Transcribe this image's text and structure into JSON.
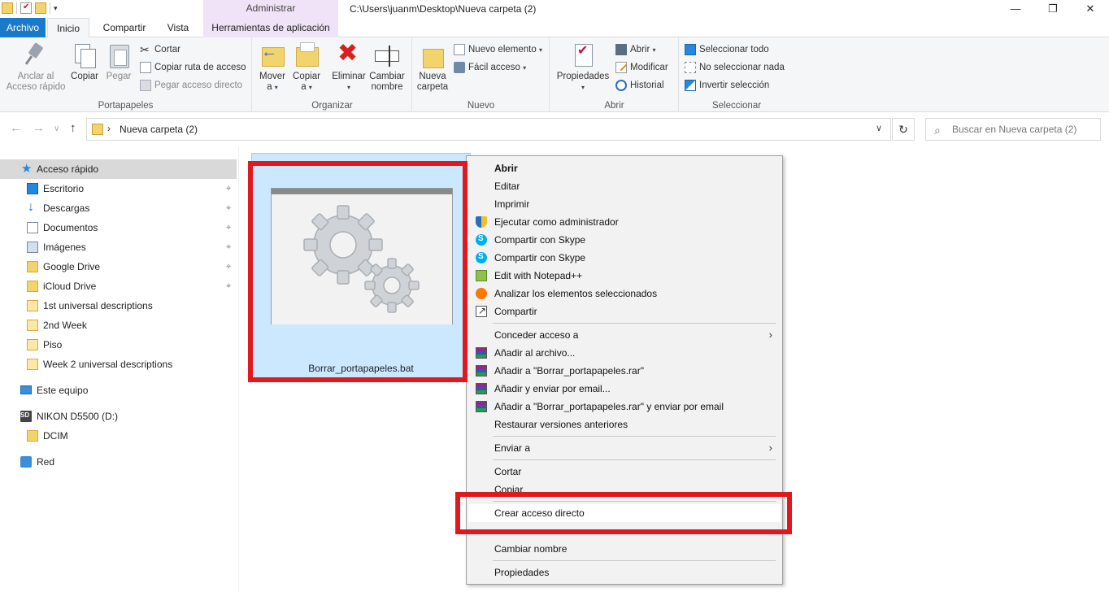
{
  "window": {
    "qat_arrow": "▾",
    "context_tab_group": "Administrar",
    "path_title": "C:\\Users\\juanm\\Desktop\\Nueva carpeta (2)",
    "minimize": "—",
    "maximize": "❐",
    "close": "✕"
  },
  "tabs": {
    "archivo": "Archivo",
    "inicio": "Inicio",
    "compartir": "Compartir",
    "vista": "Vista",
    "herramientas": "Herramientas de aplicación",
    "collapse": "∧",
    "help": "?"
  },
  "ribbon": {
    "portapapeles": {
      "label": "Portapapeles",
      "pin_line1": "Anclar al",
      "pin_line2": "Acceso rápido",
      "copy": "Copiar",
      "paste": "Pegar",
      "cut": "Cortar",
      "copy_path": "Copiar ruta de acceso",
      "paste_link": "Pegar acceso directo"
    },
    "organizar": {
      "label": "Organizar",
      "move_line1": "Mover",
      "move_line2": "a",
      "copy_line1": "Copiar",
      "copy_line2": "a",
      "delete": "Eliminar",
      "rename_line1": "Cambiar",
      "rename_line2": "nombre"
    },
    "nuevo": {
      "label": "Nuevo",
      "new_folder_line1": "Nueva",
      "new_folder_line2": "carpeta",
      "new_item": "Nuevo elemento",
      "easy_access": "Fácil acceso"
    },
    "abrir": {
      "label": "Abrir",
      "properties": "Propiedades",
      "open": "Abrir",
      "edit": "Modificar",
      "history": "Historial"
    },
    "seleccionar": {
      "label": "Seleccionar",
      "select_all": "Seleccionar todo",
      "select_none": "No seleccionar nada",
      "invert": "Invertir selección"
    },
    "dropdown_arrow": "▾"
  },
  "navbar": {
    "back": "←",
    "forward": "→",
    "recent": "∨",
    "up": "↑",
    "chevron": "›",
    "address": "Nueva carpeta (2)",
    "address_dropdown": "∨",
    "refresh": "↻",
    "search_icon": "⌕",
    "search_placeholder": "Buscar en Nueva carpeta (2)"
  },
  "sidebar": {
    "pin_glyph": "⌖",
    "quick_access": "Acceso rápido",
    "quick_items": [
      {
        "label": "Escritorio"
      },
      {
        "label": "Descargas"
      },
      {
        "label": "Documentos"
      },
      {
        "label": "Imágenes"
      },
      {
        "label": "Google Drive"
      },
      {
        "label": "iCloud Drive"
      },
      {
        "label": "1st universal descriptions"
      },
      {
        "label": "2nd Week"
      },
      {
        "label": "Piso"
      },
      {
        "label": "Week 2 universal descriptions"
      }
    ],
    "this_pc": "Este equipo",
    "drive": "NIKON D5500 (D:)",
    "drive_folder": "DCIM",
    "network": "Red"
  },
  "file": {
    "name": "Borrar_portapapeles.bat"
  },
  "context_menu": {
    "items": [
      {
        "label": "Abrir"
      },
      {
        "label": "Editar"
      },
      {
        "label": "Imprimir"
      },
      {
        "label": "Ejecutar como administrador"
      },
      {
        "label": "Compartir con Skype"
      },
      {
        "label": "Compartir con Skype"
      },
      {
        "label": "Edit with Notepad++"
      },
      {
        "label": "Analizar los elementos seleccionados"
      },
      {
        "label": "Compartir"
      },
      {
        "label": "Conceder acceso a"
      },
      {
        "label": "Añadir al archivo..."
      },
      {
        "label": "Añadir a \"Borrar_portapapeles.rar\""
      },
      {
        "label": "Añadir y enviar por email..."
      },
      {
        "label": "Añadir a \"Borrar_portapapeles.rar\" y enviar por email"
      },
      {
        "label": "Restaurar versiones anteriores"
      },
      {
        "label": "Enviar a"
      },
      {
        "label": "Cortar"
      },
      {
        "label": "Copiar"
      },
      {
        "label": "Crear acceso directo"
      },
      {
        "label": "Cambiar nombre"
      },
      {
        "label": "Propiedades"
      }
    ],
    "submenu_arrow": "›"
  }
}
